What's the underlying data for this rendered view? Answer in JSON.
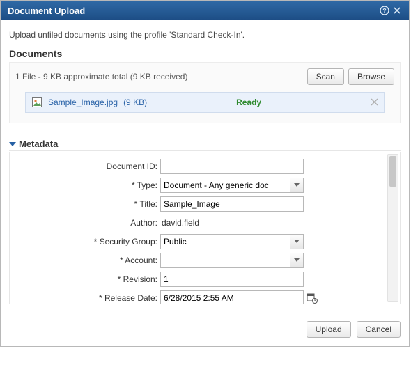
{
  "dialog": {
    "title": "Document Upload",
    "instruction": "Upload unfiled documents using the profile 'Standard Check-In'."
  },
  "documents": {
    "heading": "Documents",
    "summary": "1 File - 9 KB approximate total   (9 KB received)",
    "scan_label": "Scan",
    "browse_label": "Browse",
    "file": {
      "name": "Sample_Image.jpg",
      "size_text": "(9 KB)",
      "status": "Ready"
    }
  },
  "metadata": {
    "heading": "Metadata",
    "labels": {
      "document_id": "Document ID:",
      "type": "Type:",
      "title": "Title:",
      "author": "Author:",
      "security_group": "Security Group:",
      "account": "Account:",
      "revision": "Revision:",
      "release_date": "Release Date:"
    },
    "values": {
      "document_id": "",
      "type": "Document - Any generic doc",
      "title": "Sample_Image",
      "author": "david.field",
      "security_group": "Public",
      "account": "",
      "revision": "1",
      "release_date": "6/28/2015 2:55 AM"
    }
  },
  "footer": {
    "upload_label": "Upload",
    "cancel_label": "Cancel"
  }
}
